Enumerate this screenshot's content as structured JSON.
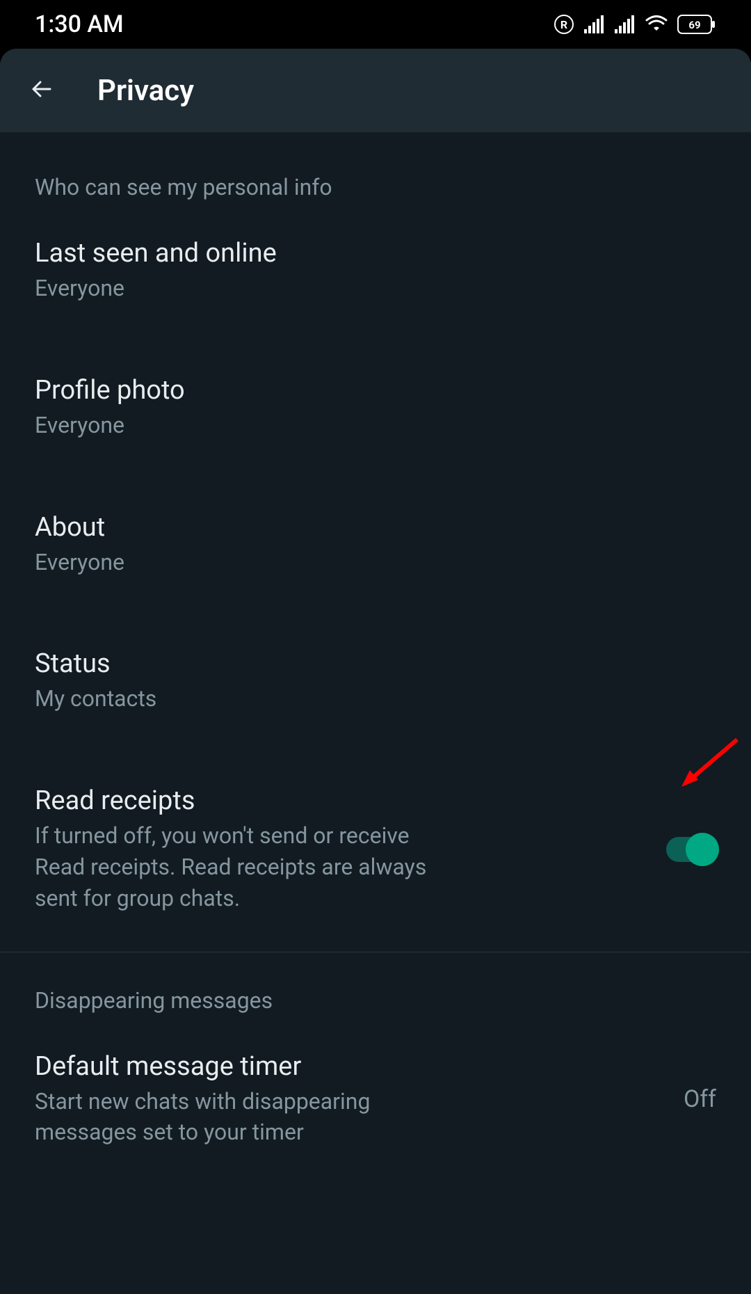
{
  "status_bar": {
    "time": "1:30 AM",
    "battery": "69"
  },
  "header": {
    "title": "Privacy"
  },
  "sections": {
    "personal_info": {
      "header": "Who can see my personal info",
      "items": {
        "last_seen": {
          "title": "Last seen and online",
          "subtitle": "Everyone"
        },
        "profile_photo": {
          "title": "Profile photo",
          "subtitle": "Everyone"
        },
        "about": {
          "title": "About",
          "subtitle": "Everyone"
        },
        "status": {
          "title": "Status",
          "subtitle": "My contacts"
        },
        "read_receipts": {
          "title": "Read receipts",
          "subtitle": "If turned off, you won't send or receive Read receipts. Read receipts are always sent for group chats."
        }
      }
    },
    "disappearing": {
      "header": "Disappearing messages",
      "items": {
        "default_timer": {
          "title": "Default message timer",
          "subtitle": "Start new chats with disappearing messages set to your timer",
          "value": "Off"
        }
      }
    }
  }
}
